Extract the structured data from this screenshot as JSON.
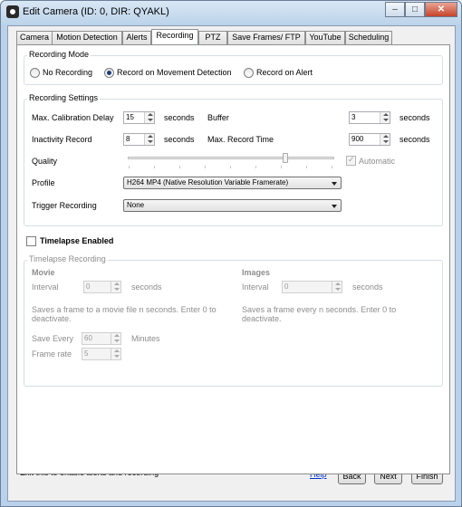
{
  "window": {
    "title": "Edit Camera (ID: 0, DIR: QYAKL)",
    "minimize_glyph": "–",
    "maximize_glyph": "□",
    "close_glyph": "✕"
  },
  "tabs": [
    {
      "label": "Camera"
    },
    {
      "label": "Motion Detection"
    },
    {
      "label": "Alerts"
    },
    {
      "label": "Recording"
    },
    {
      "label": "PTZ"
    },
    {
      "label": "Save Frames/ FTP"
    },
    {
      "label": "YouTube"
    },
    {
      "label": "Scheduling"
    }
  ],
  "active_tab": "Recording",
  "recording_mode": {
    "title": "Recording Mode",
    "options": [
      {
        "label": "No Recording",
        "selected": false
      },
      {
        "label": "Record on Movement Detection",
        "selected": true
      },
      {
        "label": "Record on Alert",
        "selected": false
      }
    ]
  },
  "recording_settings": {
    "title": "Recording Settings",
    "max_calibration_delay": {
      "label": "Max. Calibration Delay",
      "value": "15",
      "unit": "seconds"
    },
    "buffer": {
      "label": "Buffer",
      "value": "3",
      "unit": "seconds"
    },
    "inactivity_record": {
      "label": "Inactivity Record",
      "value": "8",
      "unit": "seconds"
    },
    "max_record_time": {
      "label": "Max. Record Time",
      "value": "900",
      "unit": "seconds"
    },
    "quality": {
      "label": "Quality",
      "level_fraction": 0.77
    },
    "automatic": {
      "label": "Automatic",
      "checked": true
    },
    "profile": {
      "label": "Profile",
      "value": "H264 MP4 (Native Resolution Variable Framerate)"
    },
    "trigger_recording": {
      "label": "Trigger Recording",
      "value": "None"
    }
  },
  "timelapse": {
    "enabled_label": "Timelapse Enabled",
    "enabled": false,
    "group_title": "Timelapse Recording",
    "movie": {
      "heading": "Movie",
      "interval_label": "Interval",
      "interval_value": "0",
      "interval_unit": "seconds",
      "description": "Saves a frame to a movie file n seconds. Enter 0 to deactivate.",
      "save_every_label": "Save Every",
      "save_every_value": "60",
      "save_every_unit": "Minutes",
      "frame_rate_label": "Frame rate",
      "frame_rate_value": "5"
    },
    "images": {
      "heading": "Images",
      "interval_label": "Interval",
      "interval_value": "0",
      "interval_unit": "seconds",
      "description": "Saves a frame every n seconds. Enter 0 to deactivate."
    }
  },
  "footer": {
    "status": "Exit this to enable alerts and recording",
    "help_link": "Help",
    "back": "Back",
    "next": "Next",
    "finish": "Finish"
  }
}
